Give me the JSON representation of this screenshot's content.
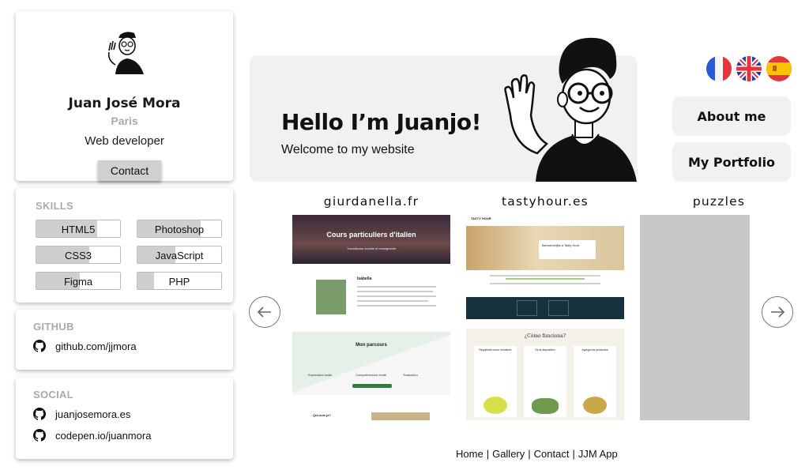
{
  "profile": {
    "name": "Juan José Mora",
    "city": "Paris",
    "role": "Web developer",
    "contact_label": "Contact"
  },
  "skills": {
    "title": "SKILLS",
    "items": [
      {
        "label": "HTML5",
        "level": 0.73
      },
      {
        "label": "Photoshop",
        "level": 0.75
      },
      {
        "label": "CSS3",
        "level": 0.63
      },
      {
        "label": "JavaScript",
        "level": 0.45
      },
      {
        "label": "Figma",
        "level": 0.52
      },
      {
        "label": "PHP",
        "level": 0.2
      }
    ]
  },
  "github": {
    "title": "GITHUB",
    "links": [
      "github.com/jjmora"
    ]
  },
  "social": {
    "title": "SOCIAL",
    "links": [
      "juanjosemora.es",
      "codepen.io/juanmora"
    ]
  },
  "hero": {
    "title": "Hello I’m Juanjo!",
    "subtitle": "Welcome to my website"
  },
  "languages": [
    "fr",
    "en",
    "es"
  ],
  "nav": {
    "about": "About me",
    "portfolio": "My Portfolio"
  },
  "gallery": [
    {
      "title": "giurdanella.fr",
      "banner": "Cours particuliers d'italien",
      "banner_sub": "Travailleuse sociale et enseignante",
      "person": "Isabella",
      "section": "Mon parcours",
      "features": [
        "Expression orale",
        "Compréhension écrite",
        "Traduction"
      ],
      "footer_heading": "Qui-suis je?"
    },
    {
      "title": "tastyhour.es",
      "logo": "TASTY HOUR",
      "hero_text": "Bienvenid@s a Tasty Hour",
      "how_title": "¿Cómo funciona?",
      "steps": [
        "Regístrate como vendedor",
        "Ve al dispositivo",
        "Agrega tus productos"
      ]
    },
    {
      "title": "puzzles"
    }
  ],
  "footer": {
    "links": [
      "Home",
      "Gallery",
      "Contact",
      "JJM App"
    ]
  },
  "colors": {
    "card_bg": "#ffffff",
    "panel_grey": "#f1f1f1",
    "skill_fill": "#cfcfcf",
    "muted_title": "#aaaaaa",
    "puzzle_placeholder": "#c8c8c8"
  }
}
